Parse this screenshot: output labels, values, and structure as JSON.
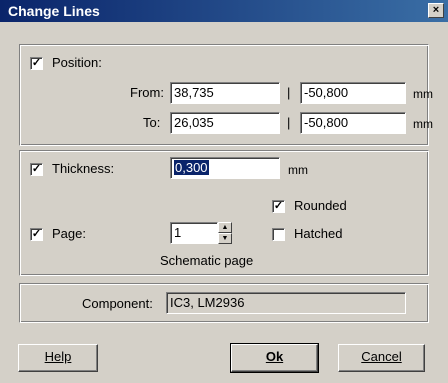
{
  "window": {
    "title": "Change Lines",
    "close_glyph": "×"
  },
  "position": {
    "label": "Position:",
    "checked": true,
    "from_label": "From:",
    "to_label": "To:",
    "separator": "|",
    "unit": "mm",
    "from_x": "38,735",
    "from_y": "-50,800",
    "to_x": "26,035",
    "to_y": "-50,800"
  },
  "thickness": {
    "label": "Thickness:",
    "checked": true,
    "value": "0,300",
    "unit": "mm"
  },
  "page": {
    "label": "Page:",
    "checked": true,
    "value": "1",
    "caption": "Schematic page",
    "rounded_label": "Rounded",
    "rounded_checked": true,
    "hatched_label": "Hatched",
    "hatched_checked": false
  },
  "component": {
    "label": "Component:",
    "value": "IC3, LM2936"
  },
  "buttons": {
    "help": "Help",
    "ok": "Ok",
    "cancel": "Cancel"
  },
  "checkmark": "✓"
}
